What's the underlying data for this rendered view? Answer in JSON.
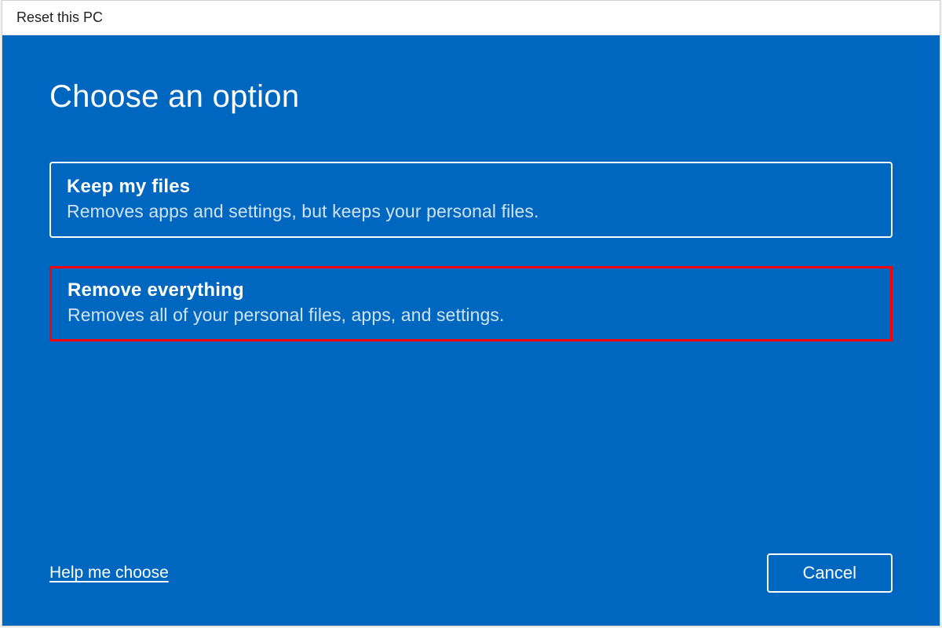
{
  "titlebar": {
    "title": "Reset this PC"
  },
  "heading": "Choose an option",
  "options": [
    {
      "title": "Keep my files",
      "description": "Removes apps and settings, but keeps your personal files.",
      "highlighted": false
    },
    {
      "title": "Remove everything",
      "description": "Removes all of your personal files, apps, and settings.",
      "highlighted": true
    }
  ],
  "footer": {
    "help_link": "Help me choose",
    "cancel_label": "Cancel"
  }
}
